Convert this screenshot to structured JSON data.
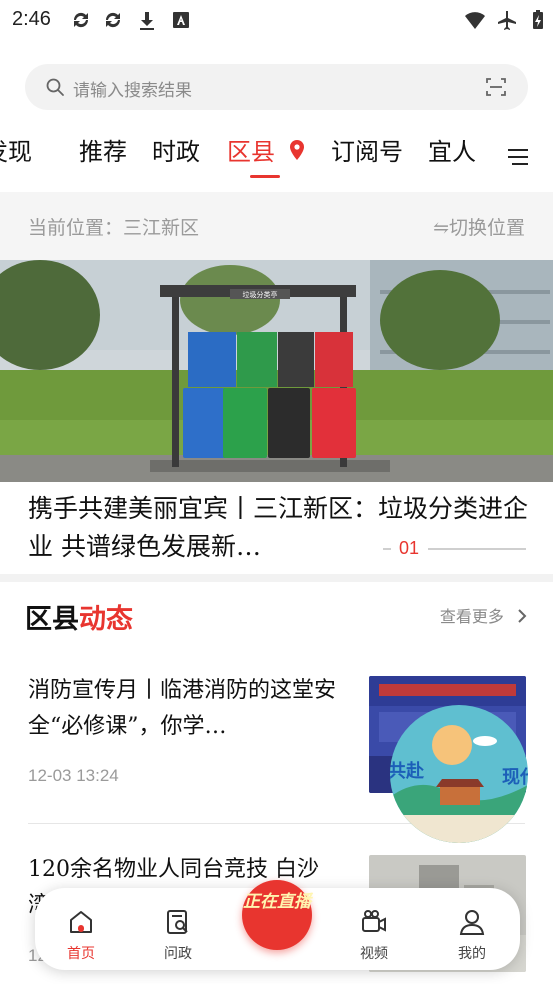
{
  "status_bar": {
    "time": "2:46",
    "left_icons": [
      "sync-icon",
      "sync-icon",
      "download-icon",
      "keyboard-a-icon"
    ],
    "right_icons": [
      "wifi-icon",
      "airplane-icon",
      "battery-charging-icon"
    ]
  },
  "search": {
    "placeholder": "请输入搜索结果",
    "scan_icon": "scan-icon"
  },
  "tabs": [
    {
      "label": "发现"
    },
    {
      "label": "推荐"
    },
    {
      "label": "时政"
    },
    {
      "label": "区县",
      "active": true
    },
    {
      "label": "订阅号"
    },
    {
      "label": "宜人"
    }
  ],
  "location": {
    "current": "当前位置：三江新区",
    "switch_label": "⇋切换位置"
  },
  "banner": {
    "caption": "携手共建美丽宜宾丨三江新区：垃圾分类进企业 共谱绿色发展新…",
    "index": "01",
    "shelter_sign": "垃圾分类亭"
  },
  "section": {
    "title_part1": "区县",
    "title_part2": "动态",
    "more_label": "查看更多"
  },
  "news": [
    {
      "title": "消防宣传月丨临港消防的这堂安全“必修课”，你学…",
      "time": "12-03  13:24"
    },
    {
      "title": "120余名物业人同台竞技 白沙湾街道第三届消防…",
      "time": "12-03  13:23"
    }
  ],
  "float_ad": {
    "left_text": "共赴",
    "right_text": "现代"
  },
  "bottom_nav": {
    "items": [
      {
        "label": "首页",
        "icon": "home-icon",
        "active": true
      },
      {
        "label": "问政",
        "icon": "inquiry-icon"
      },
      {
        "label": "视频",
        "icon": "video-icon"
      },
      {
        "label": "我的",
        "icon": "profile-icon"
      }
    ],
    "live_label": "正在直播"
  },
  "colors": {
    "accent": "#e8352f",
    "muted_text": "#9a9a9a"
  }
}
